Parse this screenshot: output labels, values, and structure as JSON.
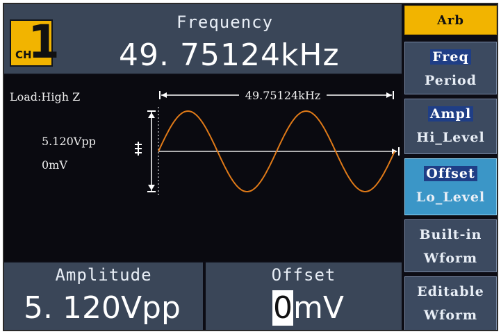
{
  "header": {
    "channel_prefix": "CH",
    "channel_number": "1",
    "param_name": "Frequency",
    "param_value": "49. 75124kHz"
  },
  "wave": {
    "load": "Load:High Z",
    "amplitude": "5.120Vpp",
    "offset": "0mV",
    "period_label": "49.75124kHz",
    "cycles": 2,
    "colors": {
      "waveform": "#e07a18",
      "markers": "#ffffff"
    }
  },
  "bottom": {
    "left_name": "Amplitude",
    "left_value": "5. 120Vpp",
    "right_name": "Offset",
    "right_value_cursor": "0",
    "right_value_rest": "mV"
  },
  "menu": {
    "arb": "Arb",
    "freq": "Freq",
    "period": "Period",
    "ampl": "Ampl",
    "hi_level": "Hi_Level",
    "offset": "Offset",
    "lo_level": "Lo_Level",
    "builtin_1": "Built-in",
    "builtin_2": "Wform",
    "editable_1": "Editable",
    "editable_2": "Wform"
  },
  "colors": {
    "panel": "#3a4658",
    "accent": "#f2b400",
    "selected_menu": "#3b96c7",
    "highlight": "#1f3e86"
  }
}
